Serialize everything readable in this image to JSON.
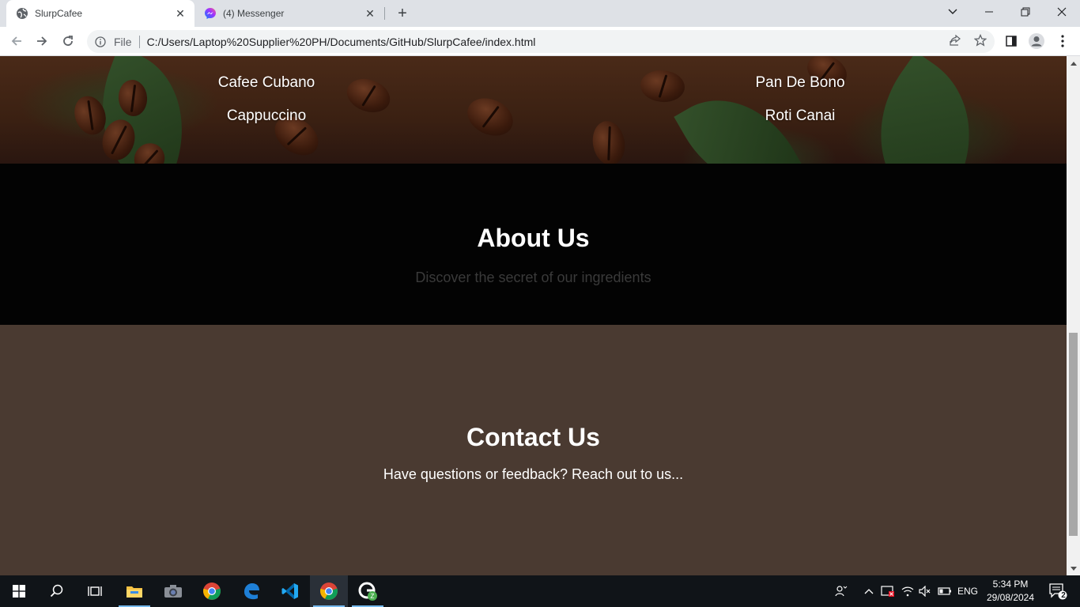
{
  "browser": {
    "tabs": [
      {
        "title": "SlurpCafee",
        "active": true
      },
      {
        "title": "(4) Messenger",
        "active": false
      }
    ],
    "omnibox": {
      "scheme_label": "File",
      "url": "C:/Users/Laptop%20Supplier%20PH/Documents/GitHub/SlurpCafee/index.html"
    }
  },
  "page": {
    "menu_left": [
      "Cafee Cubano",
      "Cappuccino"
    ],
    "menu_right": [
      "Pan De Bono",
      "Roti Canai"
    ],
    "about": {
      "title": "About Us",
      "subtitle": "Discover the secret of our ingredients"
    },
    "contact": {
      "title": "Contact Us",
      "text": "Have questions or feedback? Reach out to us..."
    }
  },
  "taskbar": {
    "language": "ENG",
    "time": "5:34 PM",
    "date": "29/08/2024",
    "notification_count": "2",
    "accent": "#76b9ed"
  },
  "colors": {
    "about_bg": "#030303",
    "contact_bg": "#4a3a31",
    "tab_strip": "#dee1e6"
  }
}
